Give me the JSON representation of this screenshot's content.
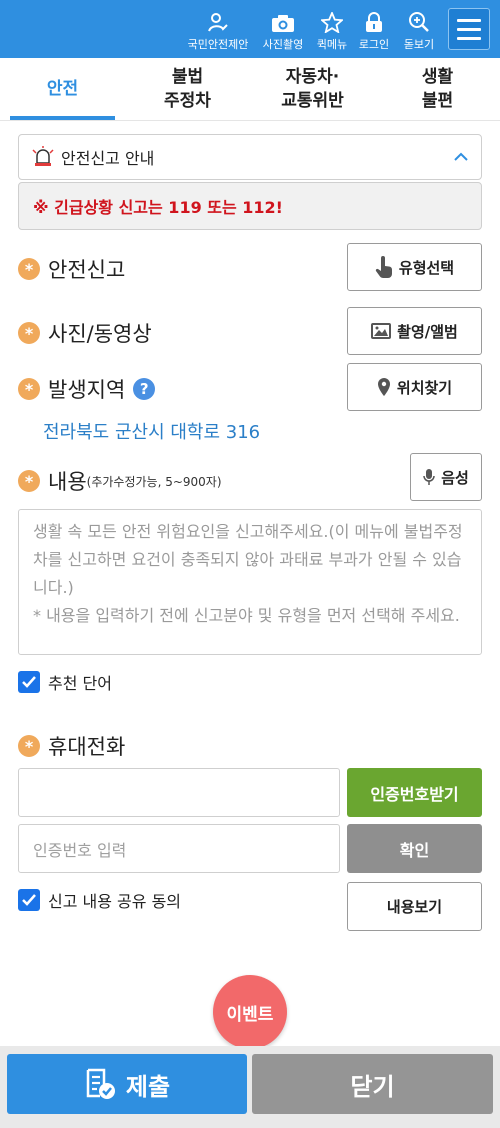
{
  "topbar": {
    "items": [
      {
        "label": "국민안전제안",
        "icon": "safety-proposal-icon"
      },
      {
        "label": "사진촬영",
        "icon": "camera-icon"
      },
      {
        "label": "퀵메뉴",
        "icon": "star-icon"
      },
      {
        "label": "로그인",
        "icon": "lock-icon"
      },
      {
        "label": "돋보기",
        "icon": "magnifier-icon"
      }
    ],
    "menu_icon": "hamburger-icon"
  },
  "tabs": [
    {
      "line1": "안전",
      "line2": "",
      "active": true
    },
    {
      "line1": "불법",
      "line2": "주정차",
      "active": false
    },
    {
      "line1": "자동차·",
      "line2": "교통위반",
      "active": false
    },
    {
      "line1": "생활",
      "line2": "불편",
      "active": false
    }
  ],
  "notice": {
    "title": "안전신고 안내",
    "message": "※ 긴급상황 신고는 119 또는 112!"
  },
  "sections": {
    "safety_report": {
      "label": "안전신고",
      "button": "유형선택"
    },
    "media": {
      "label": "사진/동영상",
      "button": "촬영/앨범"
    },
    "location": {
      "label": "발생지역",
      "help": "?",
      "button": "위치찾기",
      "address": "전라북도 군산시 대학로 316"
    },
    "content": {
      "label": "내용",
      "hint": "(추가수정가능, 5~900자)",
      "button": "음성",
      "placeholder": "생활 속 모든 안전 위험요인을 신고해주세요.(이 메뉴에 불법주정차를 신고하면 요건이 충족되지 않아 과태료 부과가 안될 수 있습니다.)\n* 내용을 입력하기 전에 신고분야 및 유형을 먼저 선택해 주세요."
    },
    "recommend": {
      "label": "추천 단어",
      "checked": true
    },
    "phone": {
      "label": "휴대전화",
      "phone_value": "",
      "verify_button": "인증번호받기",
      "code_placeholder": "인증번호 입력",
      "confirm_button": "확인"
    },
    "agree": {
      "label": "신고 내용 공유 동의",
      "checked": true,
      "view_button": "내용보기"
    }
  },
  "event_label": "이벤트",
  "footer": {
    "submit": "제출",
    "close": "닫기"
  },
  "colors": {
    "primary": "#2f8fe0",
    "green": "#6aa630",
    "gray_button": "#8f8f8f",
    "emergency": "#d0141d",
    "event": "#f2696a"
  }
}
